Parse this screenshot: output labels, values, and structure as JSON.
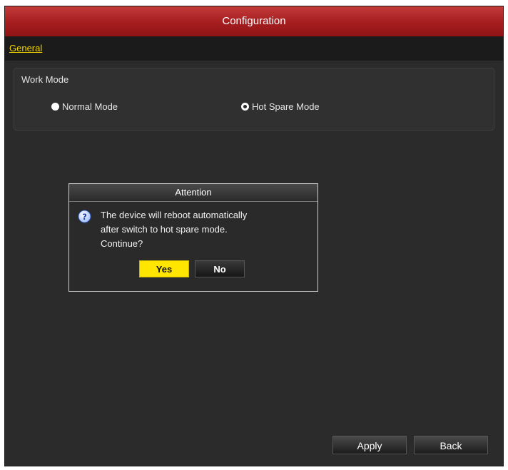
{
  "window": {
    "title": "Configuration"
  },
  "tabs": [
    {
      "label": "General",
      "active": true
    }
  ],
  "work_mode": {
    "title": "Work Mode",
    "options": [
      {
        "label": "Normal Mode",
        "selected": false
      },
      {
        "label": "Hot Spare Mode",
        "selected": true
      }
    ]
  },
  "dialog": {
    "title": "Attention",
    "icon": "question-icon",
    "message_lines": [
      "The device will reboot automatically",
      "after switch to hot spare mode.",
      "Continue?"
    ],
    "yes_label": "Yes",
    "no_label": "No"
  },
  "footer": {
    "apply_label": "Apply",
    "back_label": "Back"
  },
  "colors": {
    "titlebar": "#a61d1f",
    "accent": "#f0d400",
    "yes_button": "#ffe600"
  }
}
